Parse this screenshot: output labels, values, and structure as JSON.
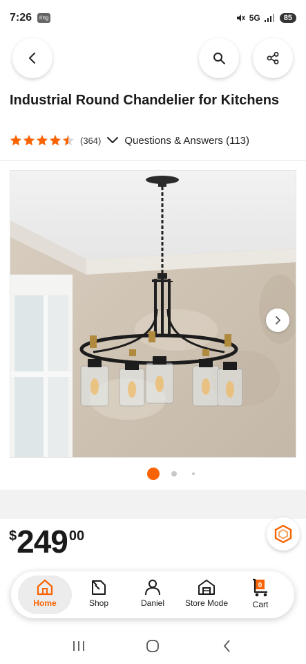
{
  "status_bar": {
    "time": "7:26",
    "ring_badge": "ring",
    "network": "5G",
    "battery": "85"
  },
  "header": {
    "back_icon": "chevron-left-icon",
    "search_icon": "search-icon",
    "share_icon": "share-icon"
  },
  "product": {
    "title": "Industrial Round Chandelier for Kitchens",
    "rating": 4.5,
    "review_count": "(364)",
    "qa_label": "Questions & Answers (113)",
    "image_count": 3,
    "active_image": 0
  },
  "price": {
    "symbol": "$",
    "dollars": "249",
    "cents": "00"
  },
  "bottom_nav": {
    "items": [
      {
        "label": "Home",
        "icon": "home-icon",
        "active": true
      },
      {
        "label": "Shop",
        "icon": "shop-icon",
        "active": false
      },
      {
        "label": "Daniel",
        "icon": "user-icon",
        "active": false
      },
      {
        "label": "Store Mode",
        "icon": "store-icon",
        "active": false
      },
      {
        "label": "Cart",
        "icon": "cart-icon",
        "active": false,
        "badge": "0"
      }
    ]
  },
  "colors": {
    "accent": "#f96302",
    "text": "#1a1a1a"
  }
}
